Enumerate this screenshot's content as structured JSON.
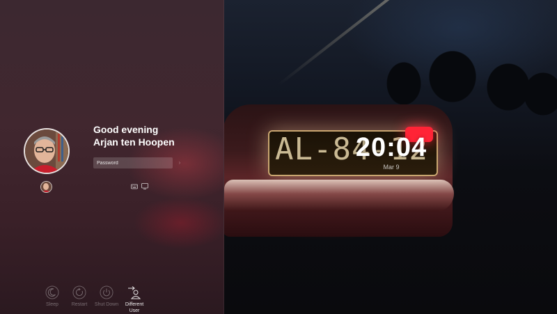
{
  "greeting": {
    "line1": "Good evening",
    "line2": "Arjan ten Hoopen"
  },
  "password": {
    "placeholder": "Password"
  },
  "clock": {
    "time": "20:04",
    "date": "Mar 9"
  },
  "actions": {
    "sleep": "Sleep",
    "restart": "Restart",
    "shutdown": "Shut Down",
    "different_user": "Different User"
  },
  "background": {
    "plate": "AL-84-12"
  },
  "icons": {
    "keyboard": "keyboard-icon",
    "screen_keyboard": "screen-keyboard-icon",
    "sleep": "sleep-icon",
    "restart": "restart-icon",
    "shutdown": "power-icon",
    "different_user": "switch-user-icon"
  },
  "colors": {
    "panel": "#3c2830",
    "text": "#ffffff",
    "dim_text": "#8c7d82"
  }
}
